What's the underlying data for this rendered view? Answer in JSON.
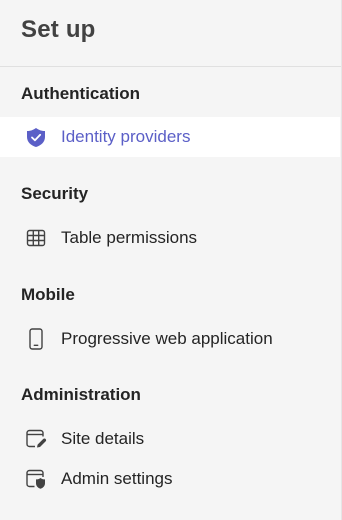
{
  "panel": {
    "title": "Set up"
  },
  "sections": [
    {
      "label": "Authentication",
      "items": [
        {
          "label": "Identity providers",
          "icon": "shield-check-icon",
          "active": true
        }
      ]
    },
    {
      "label": "Security",
      "items": [
        {
          "label": "Table permissions",
          "icon": "table-grid-icon",
          "active": false
        }
      ]
    },
    {
      "label": "Mobile",
      "items": [
        {
          "label": "Progressive web application",
          "icon": "mobile-phone-icon",
          "active": false
        }
      ]
    },
    {
      "label": "Administration",
      "items": [
        {
          "label": "Site details",
          "icon": "window-edit-icon",
          "active": false
        },
        {
          "label": "Admin settings",
          "icon": "window-shield-icon",
          "active": false
        }
      ]
    }
  ],
  "colors": {
    "accent": "#5b5fc7",
    "background": "#f5f5f5",
    "active_background": "#ffffff",
    "text": "#242424"
  }
}
